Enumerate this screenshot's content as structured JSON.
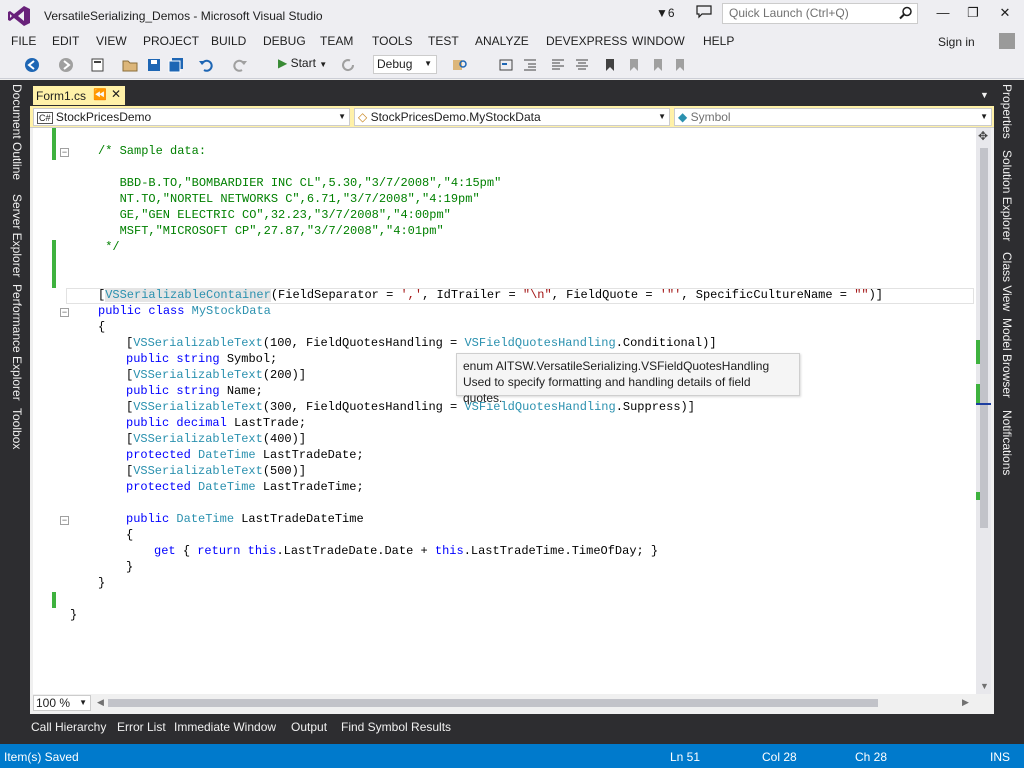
{
  "window": {
    "title": "VersatileSerializing_Demos - Microsoft Visual Studio",
    "notification_count": "6",
    "quick_launch_placeholder": "Quick Launch (Ctrl+Q)",
    "sign_in": "Sign in"
  },
  "menu": [
    "FILE",
    "EDIT",
    "VIEW",
    "PROJECT",
    "BUILD",
    "DEBUG",
    "TEAM",
    "TOOLS",
    "TEST",
    "ANALYZE",
    "DEVEXPRESS",
    "WINDOW",
    "HELP"
  ],
  "toolbar": {
    "start_label": "Start",
    "configuration": "Debug"
  },
  "left_panel": [
    "Document Outline",
    "Server Explorer",
    "Performance Explorer",
    "Toolbox"
  ],
  "right_panel": [
    "Properties",
    "Solution Explorer",
    "Class View",
    "Model Browser",
    "Notifications"
  ],
  "document_tab": {
    "label": "Form1.cs"
  },
  "navbar": {
    "project": "StockPricesDemo",
    "type": "StockPricesDemo.MyStockData",
    "member": "Symbol"
  },
  "code": {
    "l01": "/* Sample data:",
    "l03": "   BBD-B.TO,\"BOMBARDIER INC CL\",5.30,\"3/7/2008\",\"4:15pm\"",
    "l04": "   NT.TO,\"NORTEL NETWORKS C\",6.71,\"3/7/2008\",\"4:19pm\"",
    "l05": "   GE,\"GEN ELECTRIC CO\",32.23,\"3/7/2008\",\"4:00pm\"",
    "l06": "   MSFT,\"MICROSOFT CP\",27.87,\"3/7/2008\",\"4:01pm\"",
    "l07": " */",
    "attr_type": "VSSerializableContainer",
    "attr_args_1": "(FieldSeparator = ",
    "attr_str_sep": "','",
    "attr_args_2": ", IdTrailer = ",
    "attr_str_trailer": "\"\\n\"",
    "attr_args_3": ", FieldQuote = ",
    "attr_str_quote": "'\"'",
    "attr_args_4": ", SpecificCultureName = ",
    "attr_str_culture": "\"\"",
    "attr_close": ")]",
    "kw_public": "public",
    "kw_class": "class",
    "class_name": "MyStockData",
    "brace_open": "{",
    "brace_close": "}",
    "vs_text": "VSSerializableText",
    "args_100": "(100, FieldQuotesHandling = ",
    "fqh_type": "VSFieldQuotesHandling",
    "fqh_conditional": ".Conditional)]",
    "kw_string": "string",
    "field_symbol": "Symbol;",
    "args_200": "(200)]",
    "field_name": "Name;",
    "args_300": "(300, FieldQuotesHandling = ",
    "fqh_suppress": ".Suppress)]",
    "kw_decimal": "decimal",
    "field_lasttrade": "LastTrade;",
    "args_400": "(400)]",
    "kw_protected": "protected",
    "type_datetime": "DateTime",
    "field_lasttradedate": "LastTradeDate;",
    "args_500": "(500)]",
    "field_lasttradetime": "LastTradeTime;",
    "prop_name": "LastTradeDateTime",
    "kw_get": "get",
    "kw_return": "return",
    "kw_this": "this",
    "getter_1": ".LastTradeDate.Date + ",
    "getter_2": ".LastTradeTime.TimeOfDay; }"
  },
  "tooltip": {
    "line1": "enum AITSW.VersatileSerializing.VSFieldQuotesHandling",
    "line2": "Used to specify formatting and handling details of field quotes."
  },
  "zoom": "100 %",
  "bottom_tabs": [
    "Call Hierarchy",
    "Error List",
    "Immediate Window",
    "Output",
    "Find Symbol Results"
  ],
  "status": {
    "message": "Item(s) Saved",
    "line": "Ln 51",
    "col": "Col 28",
    "ch": "Ch 28",
    "mode": "INS"
  }
}
